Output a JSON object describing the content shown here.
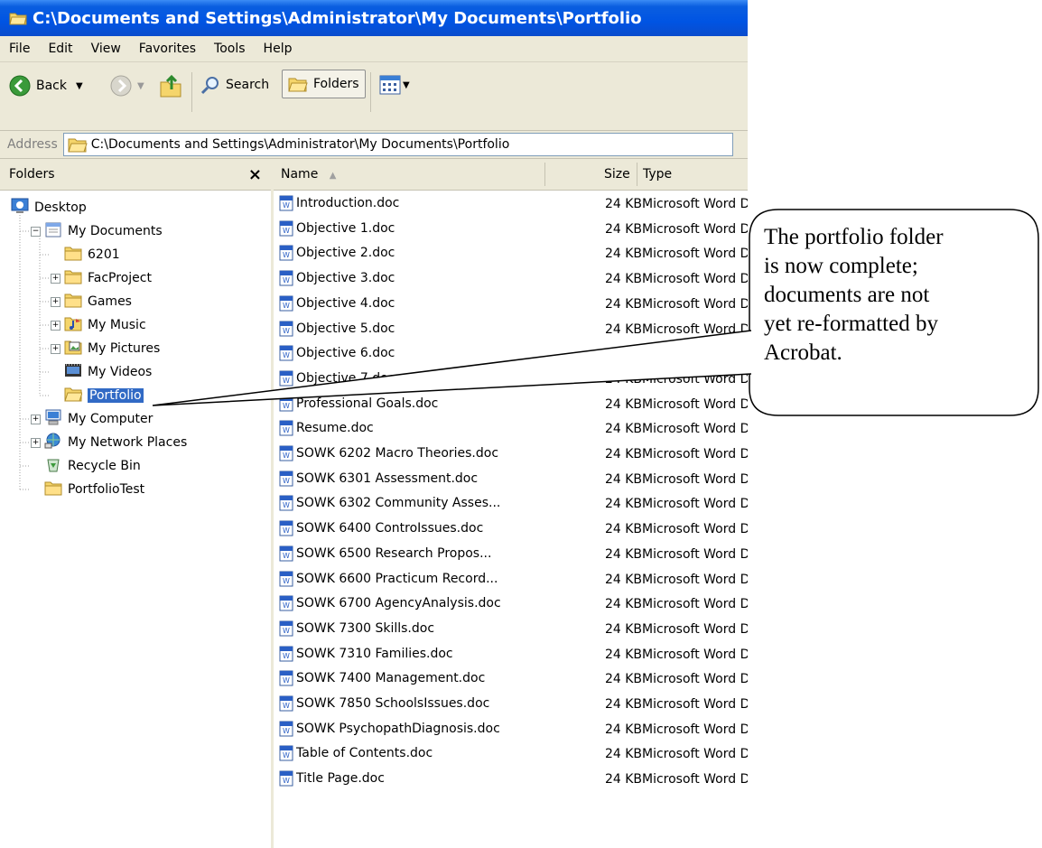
{
  "window": {
    "title": "C:\\Documents and Settings\\Administrator\\My Documents\\Portfolio"
  },
  "menu": [
    "File",
    "Edit",
    "View",
    "Favorites",
    "Tools",
    "Help"
  ],
  "toolbar": {
    "back_label": "Back",
    "search_label": "Search",
    "folders_label": "Folders"
  },
  "address": {
    "label": "Address",
    "value": "C:\\Documents and Settings\\Administrator\\My Documents\\Portfolio"
  },
  "folders_pane": {
    "title": "Folders",
    "close_glyph": "×",
    "tree": [
      {
        "label": "Desktop",
        "icon": "desktop-icon",
        "level": 0,
        "expander": "none"
      },
      {
        "label": "My Documents",
        "icon": "my-documents-icon",
        "level": 1,
        "expander": "minus"
      },
      {
        "label": "6201",
        "icon": "folder-icon",
        "level": 2,
        "expander": "none"
      },
      {
        "label": "FacProject",
        "icon": "folder-icon",
        "level": 2,
        "expander": "plus"
      },
      {
        "label": "Games",
        "icon": "folder-icon",
        "level": 2,
        "expander": "plus"
      },
      {
        "label": "My Music",
        "icon": "music-folder-icon",
        "level": 2,
        "expander": "plus"
      },
      {
        "label": "My Pictures",
        "icon": "pictures-folder-icon",
        "level": 2,
        "expander": "plus"
      },
      {
        "label": "My Videos",
        "icon": "videos-folder-icon",
        "level": 2,
        "expander": "none"
      },
      {
        "label": "Portfolio",
        "icon": "open-folder-icon",
        "level": 2,
        "expander": "none",
        "selected": true
      },
      {
        "label": "My Computer",
        "icon": "computer-icon",
        "level": 1,
        "expander": "plus"
      },
      {
        "label": "My Network Places",
        "icon": "network-icon",
        "level": 1,
        "expander": "plus"
      },
      {
        "label": "Recycle Bin",
        "icon": "recycle-bin-icon",
        "level": 1,
        "expander": "none"
      },
      {
        "label": "PortfolioTest",
        "icon": "folder-icon",
        "level": 1,
        "expander": "none"
      }
    ]
  },
  "columns": {
    "name": "Name",
    "size": "Size",
    "type": "Type"
  },
  "files": [
    {
      "name": "Introduction.doc",
      "size": "24 KB",
      "type": "Microsoft Word D"
    },
    {
      "name": "Objective 1.doc",
      "size": "24 KB",
      "type": "Microsoft Word D"
    },
    {
      "name": "Objective 2.doc",
      "size": "24 KB",
      "type": "Microsoft Word D"
    },
    {
      "name": "Objective 3.doc",
      "size": "24 KB",
      "type": "Microsoft Word D"
    },
    {
      "name": "Objective 4.doc",
      "size": "24 KB",
      "type": "Microsoft Word D"
    },
    {
      "name": "Objective 5.doc",
      "size": "24 KB",
      "type": "Microsoft Word D"
    },
    {
      "name": "Objective 6.doc",
      "size": "",
      "type": ""
    },
    {
      "name": "Objective 7.doc",
      "size": "24 KB",
      "type": "Microsoft Word D"
    },
    {
      "name": "Professional Goals.doc",
      "size": "24 KB",
      "type": "Microsoft Word D"
    },
    {
      "name": "Resume.doc",
      "size": "24 KB",
      "type": "Microsoft Word D"
    },
    {
      "name": "SOWK 6202 Macro Theories.doc",
      "size": "24 KB",
      "type": "Microsoft Word D"
    },
    {
      "name": "SOWK 6301 Assessment.doc",
      "size": "24 KB",
      "type": "Microsoft Word D"
    },
    {
      "name": "SOWK 6302 Community Asses...",
      "size": "24 KB",
      "type": "Microsoft Word D"
    },
    {
      "name": "SOWK 6400 ControIssues.doc",
      "size": "24 KB",
      "type": "Microsoft Word D"
    },
    {
      "name": "SOWK 6500 Research Propos...",
      "size": "24 KB",
      "type": "Microsoft Word D"
    },
    {
      "name": "SOWK 6600 Practicum Record...",
      "size": "24 KB",
      "type": "Microsoft Word D"
    },
    {
      "name": "SOWK 6700 AgencyAnalysis.doc",
      "size": "24 KB",
      "type": "Microsoft Word D"
    },
    {
      "name": "SOWK 7300 Skills.doc",
      "size": "24 KB",
      "type": "Microsoft Word D"
    },
    {
      "name": "SOWK 7310 Families.doc",
      "size": "24 KB",
      "type": "Microsoft Word D"
    },
    {
      "name": "SOWK 7400 Management.doc",
      "size": "24 KB",
      "type": "Microsoft Word D"
    },
    {
      "name": "SOWK 7850 SchoolsIssues.doc",
      "size": "24 KB",
      "type": "Microsoft Word D"
    },
    {
      "name": "SOWK PsychopathDiagnosis.doc",
      "size": "24 KB",
      "type": "Microsoft Word D"
    },
    {
      "name": "Table of Contents.doc",
      "size": "24 KB",
      "type": "Microsoft Word D"
    },
    {
      "name": "Title Page.doc",
      "size": "24 KB",
      "type": "Microsoft Word D"
    }
  ],
  "callout": {
    "lines": [
      "The portfolio folder",
      "is now complete;",
      "documents are not",
      "yet re-formatted by",
      "Acrobat."
    ]
  },
  "colors": {
    "titlebar": "#0054e3",
    "chrome": "#ece9d8",
    "selection": "#316ac5"
  }
}
